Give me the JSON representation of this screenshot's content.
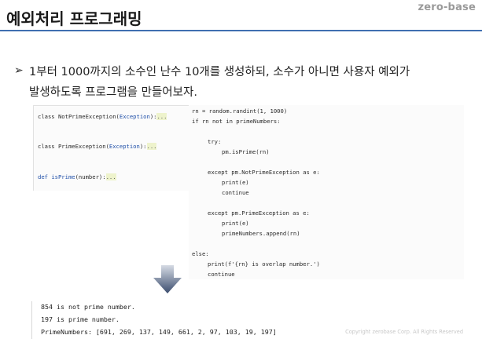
{
  "brand": "zero-base",
  "title": "예외처리 프로그래밍",
  "bullet": {
    "arrow": "➢",
    "line1": "1부터 1000까지의 소수인 난수 10개를 생성하되, 소수가 아니면 사용자 예외가",
    "line2": "발생하도록 프로그램을 만들어보자."
  },
  "left_code": {
    "line1": {
      "kw": "class",
      "name": "NotPrimeException",
      "paren_open": "(",
      "base": "Exception",
      "paren_close": "):",
      "ellipsis": "..."
    },
    "line2": {
      "kw": "class",
      "name": "PrimeException",
      "paren_open": "(",
      "base": "Exception",
      "paren_close": "):",
      "ellipsis": "..."
    },
    "line3": {
      "kw": "def",
      "name": "isPrime",
      "params": "(number):",
      "ellipsis": "..."
    }
  },
  "right_code": [
    "rn = random.randint(1, 1000)",
    "if rn not in primeNumbers:",
    "try:",
    "pm.isPrime(rn)",
    "except pm.NotPrimeException as e:",
    "print(e)",
    "continue",
    "except pm.PrimeException as e:",
    "print(e)",
    "primeNumbers.append(rn)",
    "else:",
    "print(f'{rn} is overlap number.')",
    "continue"
  ],
  "output": [
    "854 is not prime number.",
    "197 is prime number.",
    "PrimeNumbers: [691, 269, 137, 149, 661, 2, 97, 103, 19, 197]"
  ],
  "copyright": "Copyright zerobase Corp. All Rights Reserved",
  "icons": {
    "down_arrow": "down-arrow-icon"
  },
  "colors": {
    "title_rule": "#3f6fb0",
    "keyword": "#1f4fa8",
    "arrow_top": "#d6dbe4",
    "arrow_bottom": "#3b4d6e"
  }
}
